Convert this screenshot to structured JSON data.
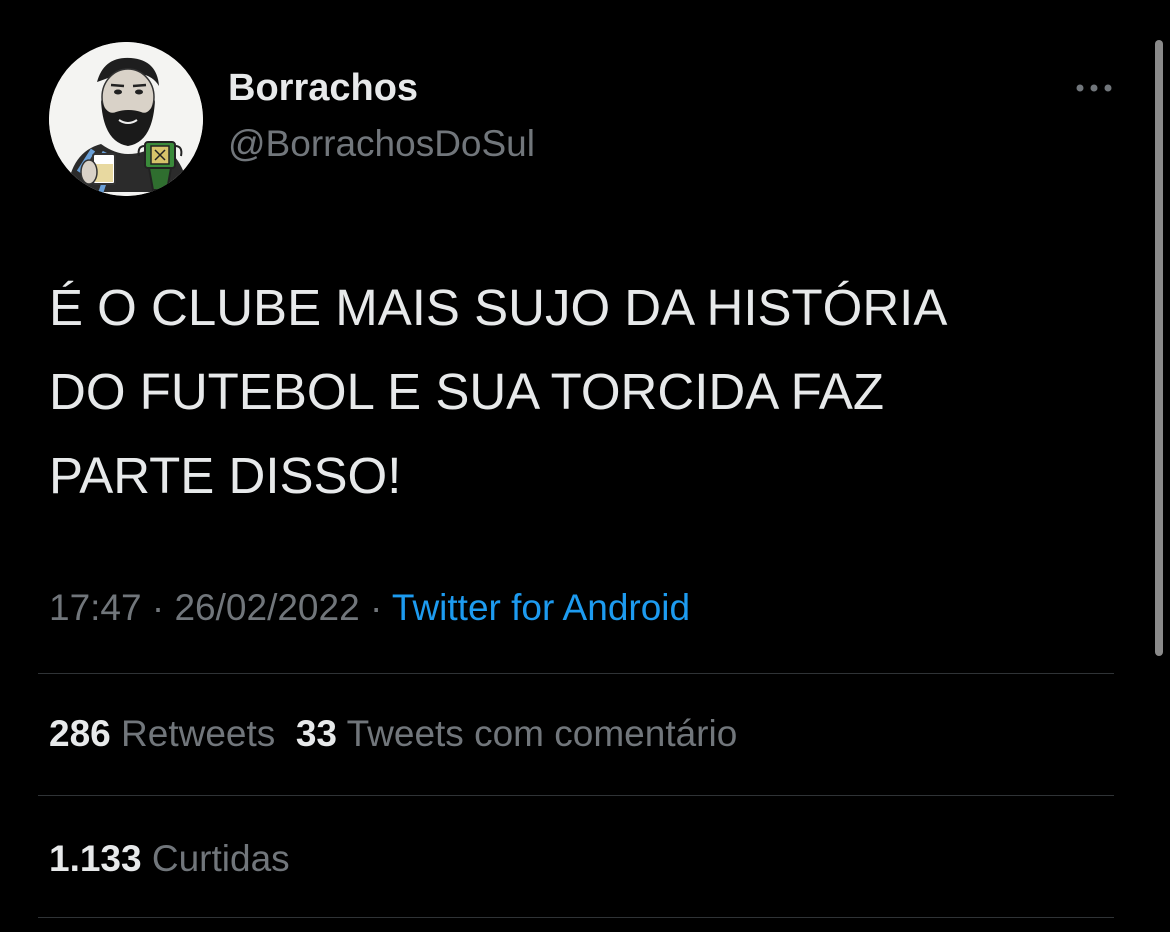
{
  "tweet": {
    "display_name": "Borrachos",
    "handle": "@BorrachosDoSul",
    "text_lines": [
      "É O CLUBE MAIS SUJO DA HISTÓRIA",
      "DO FUTEBOL E SUA TORCIDA FAZ",
      "PARTE DISSO!"
    ],
    "time": "17:47",
    "separator": "·",
    "date": "26/02/2022",
    "source": "Twitter for Android"
  },
  "stats": {
    "retweets_count": "286",
    "retweets_label": "Retweets",
    "quotes_count": "33",
    "quotes_label": "Tweets com comentário",
    "likes_count": "1.133",
    "likes_label": "Curtidas"
  },
  "icons": {
    "avatar": "caricature-avatar",
    "more": "more-horizontal-icon"
  },
  "colors": {
    "background": "#000000",
    "primary_text": "#e7e9ea",
    "secondary_text": "#71767b",
    "link": "#1d9bf0",
    "divider": "#2f3336"
  }
}
